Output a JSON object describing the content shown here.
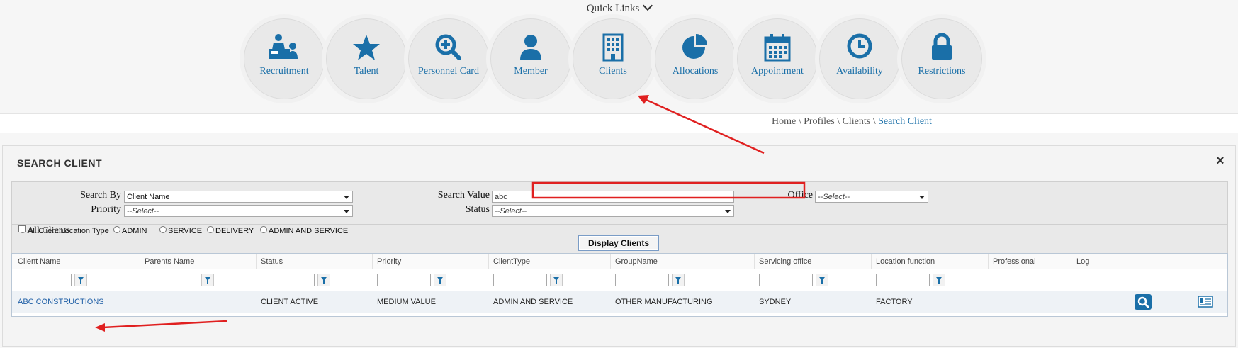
{
  "quick_links": {
    "title": "Quick Links",
    "items": [
      {
        "label": "Recruitment",
        "icon": "recruitment-icon"
      },
      {
        "label": "Talent",
        "icon": "star-icon"
      },
      {
        "label": "Personnel Card",
        "icon": "magnify-plus-icon"
      },
      {
        "label": "Member",
        "icon": "user-icon"
      },
      {
        "label": "Clients",
        "icon": "building-icon"
      },
      {
        "label": "Allocations",
        "icon": "pie-chart-icon"
      },
      {
        "label": "Appointment",
        "icon": "calendar-icon"
      },
      {
        "label": "Availability",
        "icon": "clock-icon"
      },
      {
        "label": "Restrictions",
        "icon": "lock-icon"
      }
    ]
  },
  "breadcrumb": {
    "items": [
      "Home",
      "Profiles",
      "Clients"
    ],
    "separator": "\\",
    "current": "Search Client"
  },
  "panel": {
    "title": "SEARCH CLIENT",
    "close": "×"
  },
  "form": {
    "search_by_label": "Search By",
    "search_by_value": "Client Name",
    "priority_label": "Priority",
    "priority_value": "--Select--",
    "search_value_label": "Search Value",
    "search_value": "abc",
    "status_label": "Status",
    "status_value": "--Select--",
    "office_label": "Office",
    "office_value": "--Select--",
    "location_types": [
      {
        "label": "All Client Location Type",
        "selected": true
      },
      {
        "label": "ADMIN",
        "selected": false
      },
      {
        "label": "SERVICE",
        "selected": false
      },
      {
        "label": "DELIVERY",
        "selected": false
      },
      {
        "label": "ADMIN AND SERVICE",
        "selected": false
      }
    ],
    "all_clients_label": "All Clients",
    "display_button": "Display Clients"
  },
  "grid": {
    "columns": [
      "Client Name",
      "Parents Name",
      "Status",
      "Priority",
      "ClientType",
      "GroupName",
      "Servicing office",
      "Location function",
      "Professional",
      "Log"
    ],
    "rows": [
      {
        "client_name": "ABC CONSTRUCTIONS",
        "parents_name": "",
        "status": "CLIENT ACTIVE",
        "priority": "MEDIUM VALUE",
        "client_type": "ADMIN AND SERVICE",
        "group_name": "OTHER MANUFACTURING",
        "servicing_office": "SYDNEY",
        "location_function": "FACTORY"
      }
    ]
  },
  "colors": {
    "accent": "#1a6fa8",
    "annotation": "#e02020"
  }
}
